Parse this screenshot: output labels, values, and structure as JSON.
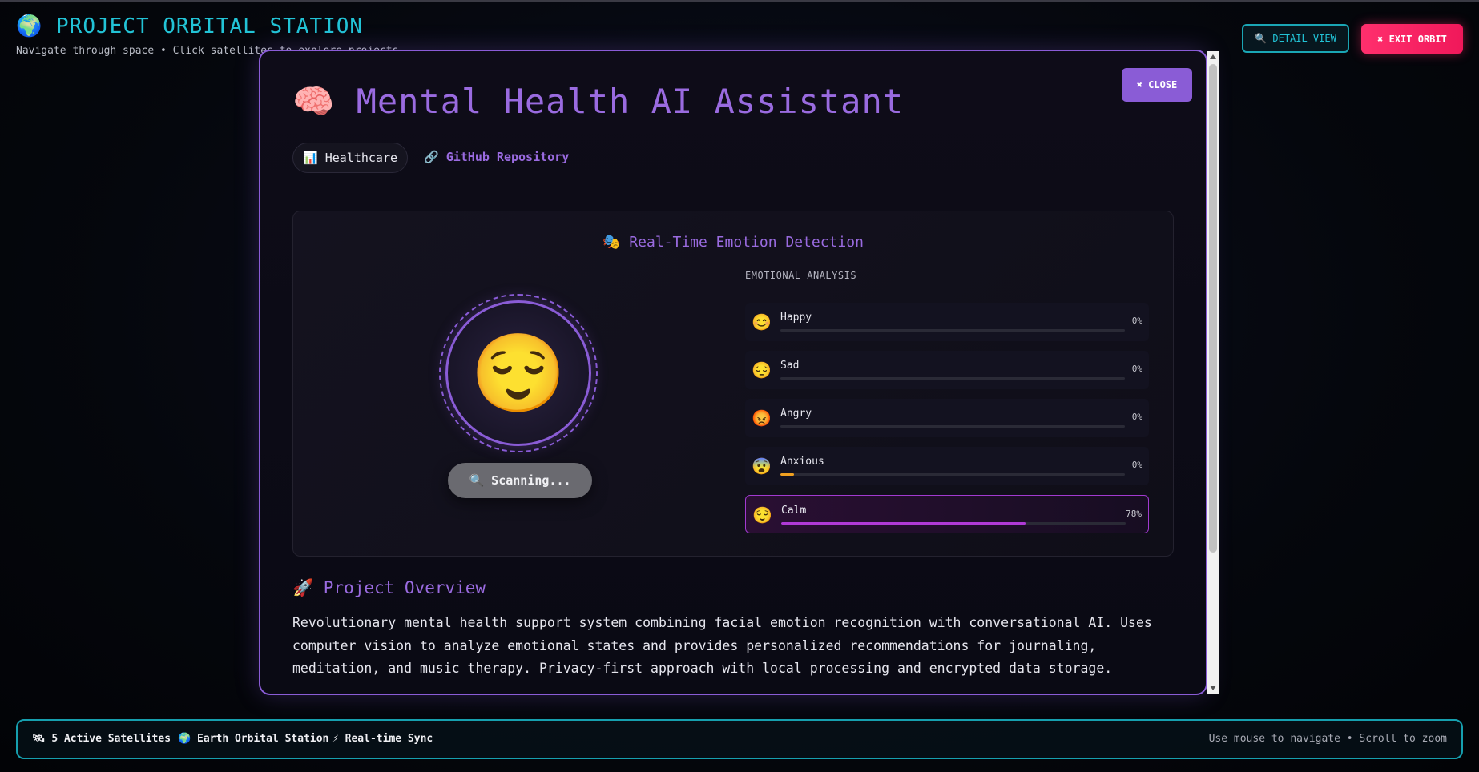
{
  "header": {
    "title": "🌍 PROJECT ORBITAL STATION",
    "subtitle": "Navigate through space • Click satellites to explore projects",
    "detail_view_label": "🔍 DETAIL VIEW",
    "exit_label": "✖ EXIT ORBIT"
  },
  "modal": {
    "close_label": "✖ CLOSE",
    "title": "🧠 Mental Health AI Assistant",
    "category_tag": "📊 Healthcare",
    "github_link": "🔗 GitHub Repository",
    "emotion_panel": {
      "title": "🎭 Real-Time Emotion Detection",
      "current_emoji": "😌",
      "scan_label": "🔍 Scanning...",
      "analysis_label": "EMOTIONAL ANALYSIS",
      "emotions": [
        {
          "emoji": "😊",
          "name": "Happy",
          "percent_label": "0%",
          "fill": 0.0,
          "color": "#8a5cd6"
        },
        {
          "emoji": "😔",
          "name": "Sad",
          "percent_label": "0%",
          "fill": 0.0,
          "color": "#8a5cd6"
        },
        {
          "emoji": "😡",
          "name": "Angry",
          "percent_label": "0%",
          "fill": 0.0,
          "color": "#8a5cd6"
        },
        {
          "emoji": "😨",
          "name": "Anxious",
          "percent_label": "0%",
          "fill": 0.04,
          "color": "#f0a020"
        },
        {
          "emoji": "😌",
          "name": "Calm",
          "percent_label": "78%",
          "fill": 0.71,
          "color": "#b03ad6"
        }
      ]
    },
    "overview": {
      "title": "🚀 Project Overview",
      "text": "Revolutionary mental health support system combining facial emotion recognition with conversational AI. Uses computer vision to analyze emotional states and provides personalized recommendations for journaling, meditation, and music therapy. Privacy-first approach with local processing and encrypted data storage."
    }
  },
  "footer": {
    "satellites": "🛰 5 Active Satellites",
    "station": "🌍 Earth Orbital Station",
    "sync": "⚡ Real-time Sync",
    "hint": "Use mouse to navigate • Scroll to zoom"
  }
}
